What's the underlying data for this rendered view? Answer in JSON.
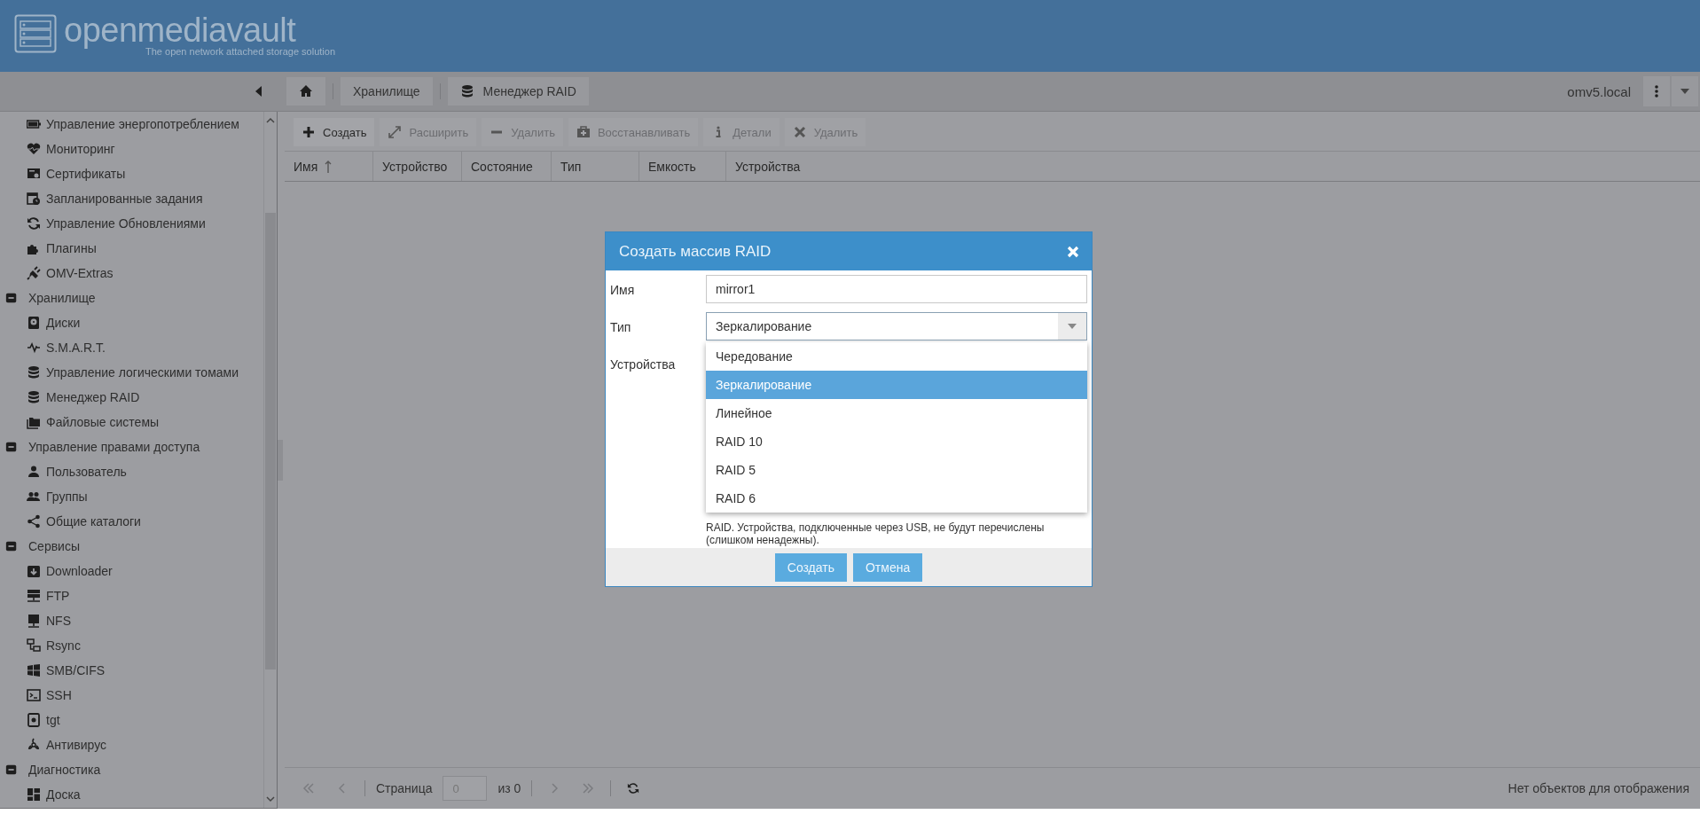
{
  "header": {
    "logo": "openmediavault",
    "tagline": "The open network attached storage solution"
  },
  "breadcrumb": {
    "items": [
      "Хранилище",
      "Менеджер RAID"
    ],
    "host": "omv5.local"
  },
  "sidebar": {
    "items": [
      {
        "label": "Управление энергопотреблением"
      },
      {
        "label": "Мониторинг"
      },
      {
        "label": "Сертификаты"
      },
      {
        "label": "Запланированные задания"
      },
      {
        "label": "Управление Обновлениями"
      },
      {
        "label": "Плагины"
      },
      {
        "label": "OMV-Extras"
      }
    ],
    "groups": [
      {
        "label": "Хранилище",
        "expanded": true,
        "children": [
          {
            "label": "Диски"
          },
          {
            "label": "S.M.A.R.T."
          },
          {
            "label": "Управление логическими томами"
          },
          {
            "label": "Менеджер RAID"
          },
          {
            "label": "Файловые системы"
          }
        ]
      },
      {
        "label": "Управление правами доступа",
        "expanded": true,
        "children": [
          {
            "label": "Пользователь"
          },
          {
            "label": "Группы"
          },
          {
            "label": "Общие каталоги"
          }
        ]
      },
      {
        "label": "Сервисы",
        "expanded": true,
        "children": [
          {
            "label": "Downloader"
          },
          {
            "label": "FTP"
          },
          {
            "label": "NFS"
          },
          {
            "label": "Rsync"
          },
          {
            "label": "SMB/CIFS"
          },
          {
            "label": "SSH"
          },
          {
            "label": "tgt"
          },
          {
            "label": "Антивирус"
          }
        ]
      },
      {
        "label": "Диагностика",
        "expanded": true,
        "children": [
          {
            "label": "Доска"
          }
        ]
      }
    ]
  },
  "toolbar": [
    {
      "label": "Создать",
      "disabled": false
    },
    {
      "label": "Расширить",
      "disabled": true
    },
    {
      "label": "Удалить",
      "disabled": true
    },
    {
      "label": "Восстанавливать",
      "disabled": true
    },
    {
      "label": "Детали",
      "disabled": true
    },
    {
      "label": "Удалить",
      "disabled": true
    }
  ],
  "table": {
    "columns": [
      {
        "label": "Имя",
        "sorted": true
      },
      {
        "label": "Устройство"
      },
      {
        "label": "Состояние"
      },
      {
        "label": "Тип"
      },
      {
        "label": "Емкость"
      },
      {
        "label": "Устройства"
      }
    ]
  },
  "pager": {
    "page_label": "Страница",
    "page_value": "0",
    "of_label": "из 0",
    "status": "Нет объектов для отображения"
  },
  "dialog": {
    "title": "Создать массив RAID",
    "fields": [
      {
        "kind": "text",
        "label": "Имя",
        "value": "mirror1"
      },
      {
        "kind": "select",
        "label": "Тип",
        "value": "Зеркалирование",
        "expanded": true,
        "options": [
          {
            "label": "Чередование",
            "selected": false
          },
          {
            "label": "Зеркалирование",
            "selected": true
          },
          {
            "label": "Линейное",
            "selected": false
          },
          {
            "label": "RAID 10",
            "selected": false
          },
          {
            "label": "RAID 5",
            "selected": false
          },
          {
            "label": "RAID 6",
            "selected": false
          }
        ]
      },
      {
        "kind": "devices",
        "label": "Устройства",
        "help": "RAID. Устройства, подключенные через USB, не будут перечислены (слишком ненадежны)."
      }
    ],
    "buttons": [
      "Создать",
      "Отмена"
    ]
  }
}
